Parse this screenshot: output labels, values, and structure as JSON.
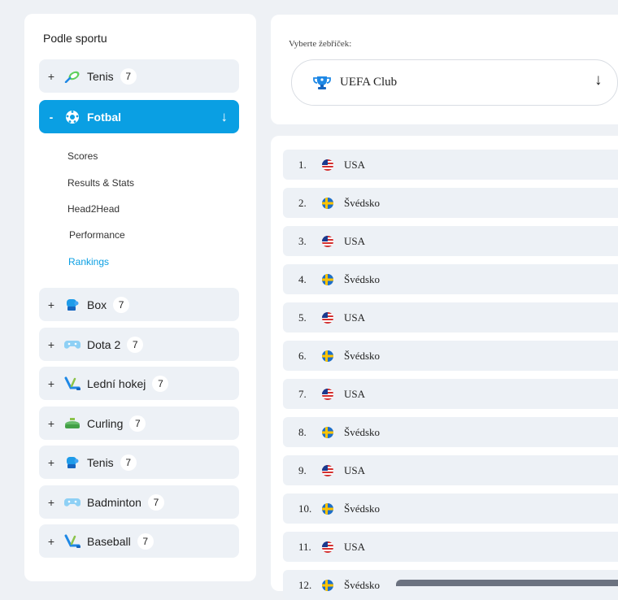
{
  "sidebar": {
    "title": "Podle sportu",
    "sports": [
      {
        "sign": "+",
        "label": "Tenis",
        "count": "7",
        "icon": "tennis-racket-icon"
      },
      {
        "sign": "-",
        "label": "Fotbal",
        "arrow": "↓",
        "icon": "football-icon"
      },
      {
        "sign": "+",
        "label": "Box",
        "count": "7",
        "icon": "boxing-glove-icon"
      },
      {
        "sign": "+",
        "label": "Dota 2",
        "count": "7",
        "icon": "gamepad-icon"
      },
      {
        "sign": "+",
        "label": "Lední hokej",
        "count": "7",
        "icon": "hockey-stick-icon"
      },
      {
        "sign": "+",
        "label": "Curling",
        "count": "7",
        "icon": "curling-stone-icon"
      },
      {
        "sign": "+",
        "label": "Tenis",
        "count": "7",
        "icon": "boxing-glove-icon"
      },
      {
        "sign": "+",
        "label": "Badminton",
        "count": "7",
        "icon": "gamepad-icon"
      },
      {
        "sign": "+",
        "label": "Baseball",
        "count": "7",
        "icon": "hockey-stick-icon"
      }
    ],
    "subitems": [
      "Scores",
      "Results & Stats",
      "Head2Head",
      "Performance",
      "Rankings"
    ],
    "active_subitem": "Rankings"
  },
  "selector": {
    "label": "Vyberte žebříček:",
    "value": "UEFA Club",
    "arrow": "↓",
    "icon": "trophy-icon"
  },
  "rankings": [
    {
      "rank": "1.",
      "country": "USA",
      "flag": "usa-flag-icon"
    },
    {
      "rank": "2.",
      "country": "Švédsko",
      "flag": "sweden-flag-icon"
    },
    {
      "rank": "3.",
      "country": "USA",
      "flag": "usa-flag-icon"
    },
    {
      "rank": "4.",
      "country": "Švédsko",
      "flag": "sweden-flag-icon"
    },
    {
      "rank": "5.",
      "country": "USA",
      "flag": "usa-flag-icon"
    },
    {
      "rank": "6.",
      "country": "Švédsko",
      "flag": "sweden-flag-icon"
    },
    {
      "rank": "7.",
      "country": "USA",
      "flag": "usa-flag-icon"
    },
    {
      "rank": "8.",
      "country": "Švédsko",
      "flag": "sweden-flag-icon"
    },
    {
      "rank": "9.",
      "country": "USA",
      "flag": "usa-flag-icon"
    },
    {
      "rank": "10.",
      "country": "Švédsko",
      "flag": "sweden-flag-icon"
    },
    {
      "rank": "11.",
      "country": "USA",
      "flag": "usa-flag-icon"
    },
    {
      "rank": "12.",
      "country": "Švédsko",
      "flag": "sweden-flag-icon"
    }
  ],
  "colors": {
    "accent": "#0a9fe3",
    "row_bg": "#edf1f6",
    "page_bg": "#eef1f5"
  }
}
